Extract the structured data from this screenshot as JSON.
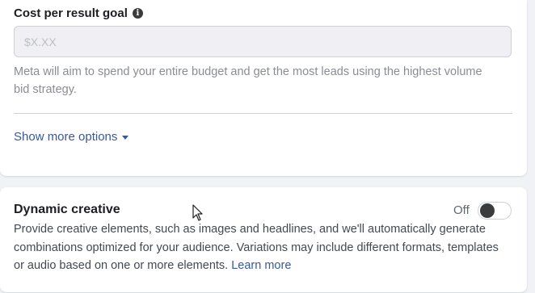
{
  "cost_section": {
    "label": "Cost per result goal",
    "info_icon": "info-icon",
    "input_value": "",
    "input_placeholder": "$X.XX",
    "helper_text": "Meta will aim to spend your entire budget and get the most leads using the highest volume bid strategy."
  },
  "show_more": {
    "label": "Show more options",
    "icon": "caret-down-icon"
  },
  "dynamic_creative": {
    "title": "Dynamic creative",
    "toggle_label": "Off",
    "toggle_on": false,
    "description": "Provide creative elements, such as images and headlines, and we'll automatically generate combinations optimized for your audience. Variations may include different formats, templates or audio based on one or more elements.",
    "learn_more": "Learn more"
  },
  "colors": {
    "link": "#385898",
    "background": "#f0f2f5",
    "card": "#ffffff",
    "toggle_knob": "#3a3b3c"
  }
}
